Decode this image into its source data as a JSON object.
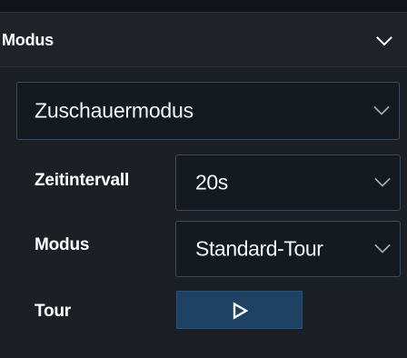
{
  "panel": {
    "title": "Modus",
    "collapse_icon": "chevron-down-icon"
  },
  "view_mode": {
    "selected": "Zuschauermodus"
  },
  "settings": {
    "interval_label": "Zeitintervall",
    "interval_value": "20s",
    "mode_label": "Modus",
    "mode_value": "Standard-Tour",
    "tour_label": "Tour",
    "tour_button_icon": "play-icon"
  },
  "colors": {
    "background": "#1c1f24",
    "dropdown_background": "#151920",
    "border": "#3b4b5c",
    "button_background": "#1d4263",
    "text": "#ffffff"
  }
}
